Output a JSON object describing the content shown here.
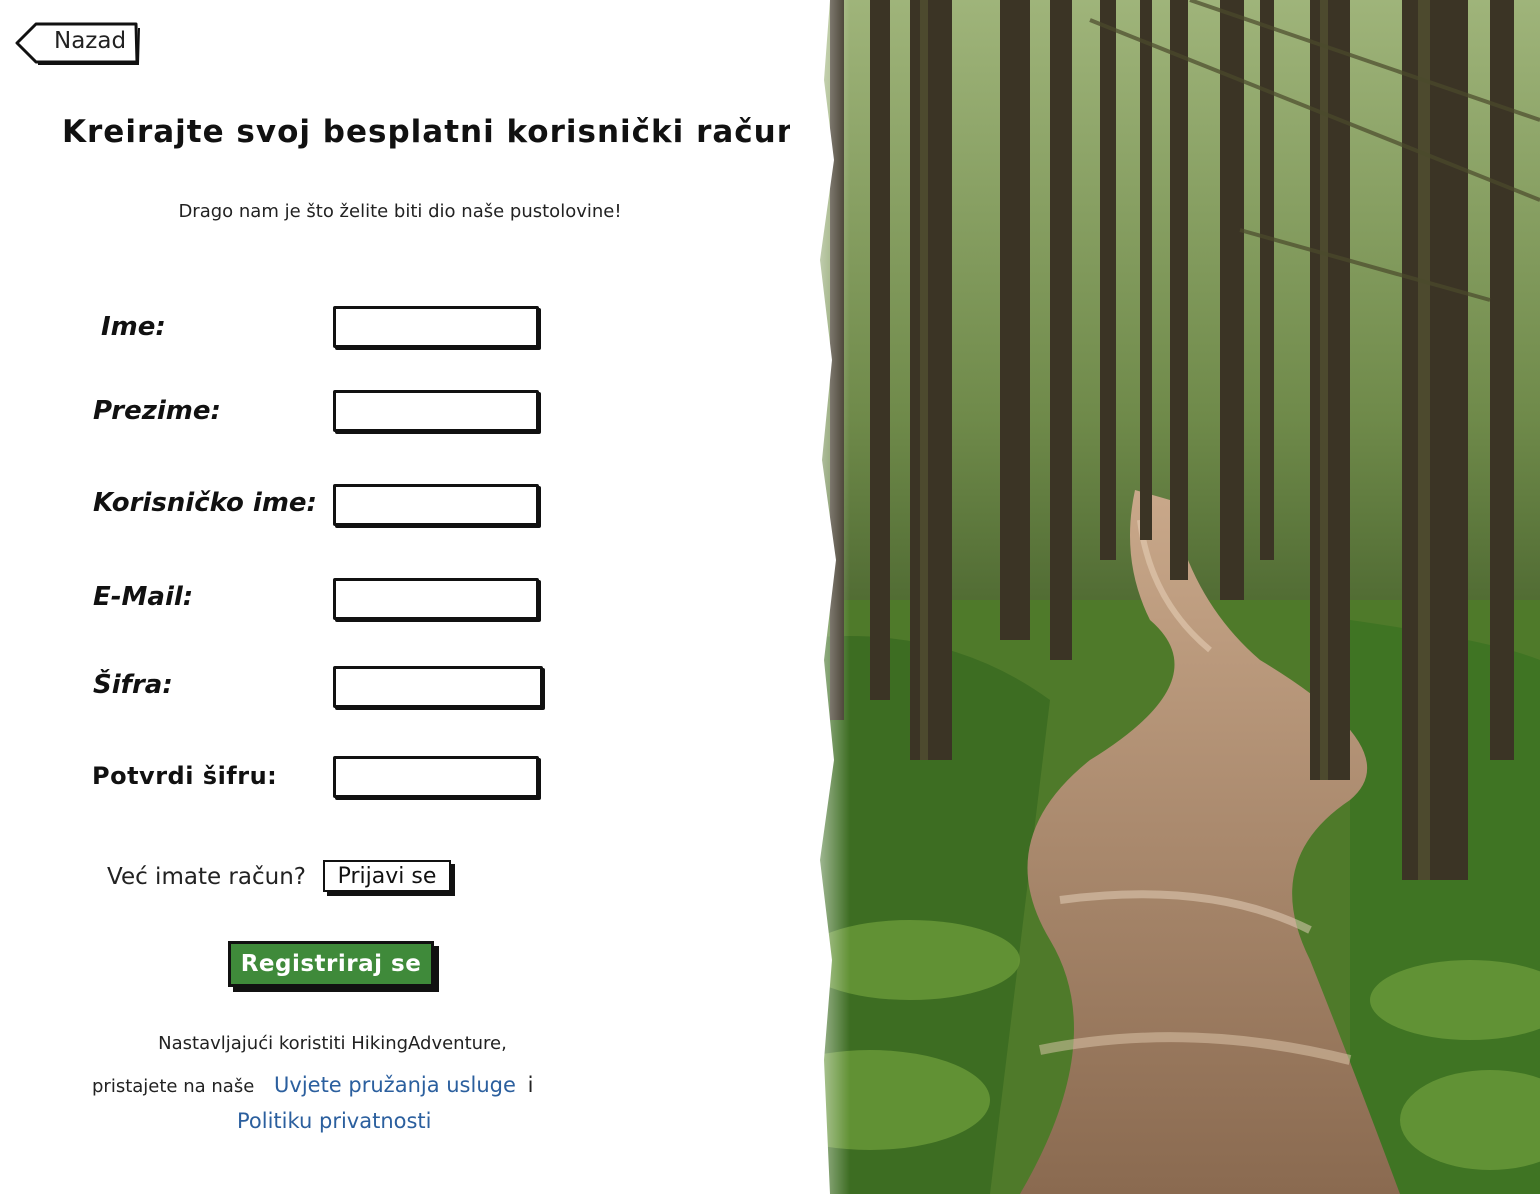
{
  "nav": {
    "back_label": "Nazad"
  },
  "header": {
    "title": "Kreirajte svoj besplatni korisnički račun",
    "subtitle": "Drago nam je što želite biti dio naše pustolovine!"
  },
  "form": {
    "fields": [
      {
        "label": "Ime:",
        "value": ""
      },
      {
        "label": "Prezime:",
        "value": ""
      },
      {
        "label": "Korisničko ime:",
        "value": ""
      },
      {
        "label": "E-Mail:",
        "value": ""
      },
      {
        "label": "Šifra:",
        "value": ""
      },
      {
        "label": "Potvrdi šifru:",
        "value": ""
      }
    ]
  },
  "login": {
    "prompt": "Već imate račun?",
    "button_label": "Prijavi se"
  },
  "register": {
    "button_label": "Registriraj se"
  },
  "terms": {
    "line1": "Nastavljajući koristiti HikingAdventure,",
    "line2_prefix": "pristajete na naše",
    "terms_link": "Uvjete pružanja usluge",
    "conjunction": "i",
    "privacy_link": "Politiku privatnosti"
  },
  "hero": {
    "image": "forest-path-photo"
  },
  "colors": {
    "accent_green": "#3f8a3a",
    "link_blue": "#2b5f9e",
    "ink": "#111111"
  }
}
